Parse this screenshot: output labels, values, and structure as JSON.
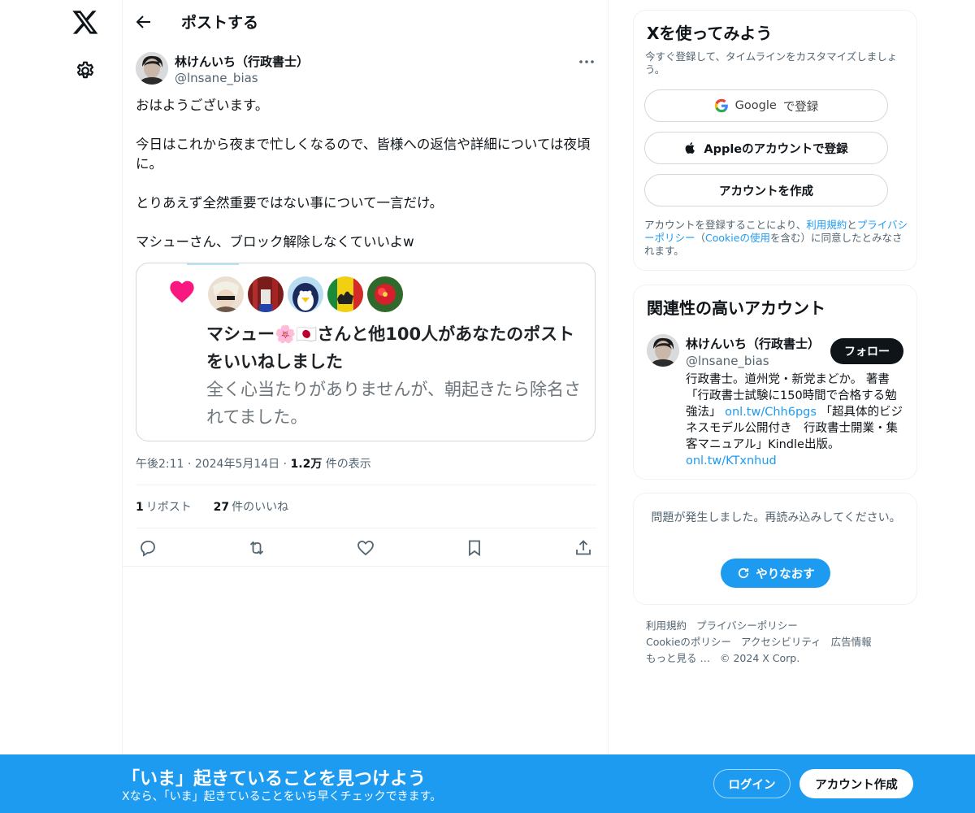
{
  "nav": {
    "logo": "x-logo-icon",
    "settings": "gear-icon"
  },
  "header": {
    "title": "ポストする"
  },
  "post": {
    "author_name": "林けんいち（行政書士）",
    "author_handle": "@lnsane_bias",
    "paragraphs": [
      "おはようございます。",
      "今日はこれから夜まで忙しくなるので、皆様への返信や詳細については夜頃に。",
      "とりあえず全然重要ではない事について一言だけ。",
      "マシューさん、ブロック解除しなくていいよw"
    ],
    "image": {
      "line1": "マシュー🌸🇯🇵さんと他100人があなたのポストをいいねしました",
      "line2": "全く心当たりがありませんが、朝起きたら除名されてました。"
    },
    "time": "午後2:11",
    "date": "2024年5月14日",
    "views_count": "1.2万",
    "views_label": "件の表示",
    "reposts_count": "1",
    "reposts_label": "リポスト",
    "likes_count": "27",
    "likes_label": "件のいいね"
  },
  "signup_card": {
    "title": "Xを使ってみよう",
    "subtitle": "今すぐ登録して、タイムラインをカスタマイズしましょう。",
    "google_brand": "Google",
    "google_suffix": "で登録",
    "apple_label": "Appleのアカウントで登録",
    "create_label": "アカウントを作成",
    "legal_prefix": "アカウントを登録することにより、",
    "legal_terms": "利用規約",
    "legal_and": "と",
    "legal_privacy": "プライバシーポリシー",
    "legal_open": "（",
    "legal_cookie": "Cookieの使用",
    "legal_suffix": "を含む）に同意したとみなされます。"
  },
  "related_card": {
    "title": "関連性の高いアカウント",
    "name": "林けんいち（行政書士）",
    "handle": "@lnsane_bias",
    "follow_label": "フォロー",
    "bio_1": "行政書士。道州党・新党まどか。 著書「行政書士試験に150時間で合格する勉強法」",
    "bio_link1": "onl.tw/Chh6pgs",
    "bio_2": "「超具体的ビジネスモデル公開付き　行政書士開業・集客マニュアル」Kindle出版。",
    "bio_link2": "onl.tw/KTxnhud"
  },
  "error_card": {
    "message": "問題が発生しました。再読み込みしてください。",
    "retry_label": "やりなおす"
  },
  "footer": {
    "links": [
      "利用規約",
      "プライバシーポリシー",
      "Cookieのポリシー",
      "アクセシビリティ",
      "広告情報",
      "もっと見る …",
      "© 2024 X Corp."
    ]
  },
  "bottom_bar": {
    "title": "「いま」起きていることを見つけよう",
    "subtitle": "Xなら、「いま」起きていることをいち早くチェックできます。",
    "login_label": "ログイン",
    "signup_label": "アカウント作成"
  },
  "colors": {
    "accent": "#1d9bf0",
    "text": "#0f1419",
    "muted": "#536471"
  }
}
